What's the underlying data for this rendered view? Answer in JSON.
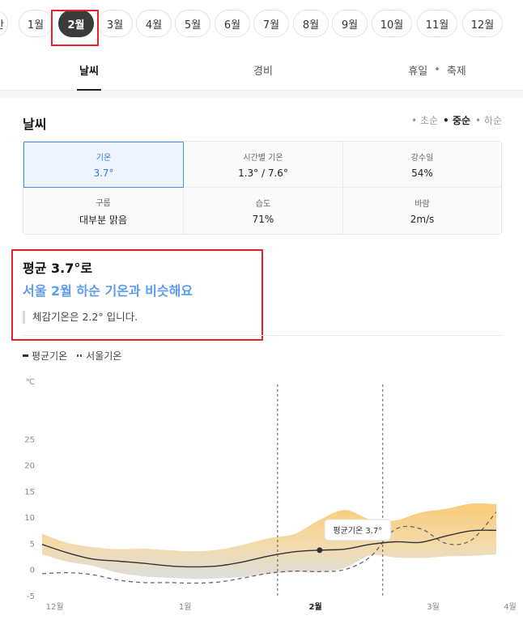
{
  "months": {
    "items": [
      "간",
      "1월",
      "2월",
      "3월",
      "4월",
      "5월",
      "6월",
      "7월",
      "8월",
      "9월",
      "10월",
      "11월",
      "12월"
    ],
    "selected": "2월"
  },
  "tabs": {
    "weather": "날씨",
    "cost": "경비",
    "holiday": "휴일",
    "festival": "축제"
  },
  "section": {
    "title": "날씨",
    "periods": [
      "초순",
      "중순",
      "하순"
    ],
    "selected_period": "중순"
  },
  "stats": [
    {
      "label": "기온",
      "value": "3.7°"
    },
    {
      "label": "시간별 기온",
      "value": "1.3° / 7.6°"
    },
    {
      "label": "강수일",
      "value": "54%"
    },
    {
      "label": "구름",
      "value": "대부분 맑음"
    },
    {
      "label": "습도",
      "value": "71%"
    },
    {
      "label": "바람",
      "value": "2m/s"
    }
  ],
  "summary": {
    "line1": "평균 3.7°로",
    "line2": "서울 2월 하순 기온과 비슷해요",
    "note": "체감기온은 2.2° 입니다."
  },
  "legend": {
    "avg": "평균기온",
    "seoul": "서울기온"
  },
  "colors": {
    "accent": "#5b9cf0",
    "band_top": "#fbc86f",
    "band_bottom": "#e0ddd7",
    "highlight": "#e8212b"
  },
  "chart_data": {
    "type": "area",
    "unit": "℃",
    "ylim": [
      -5,
      30
    ],
    "yticks": [
      -5,
      0,
      5,
      10,
      15,
      20,
      25
    ],
    "xlim": [
      0,
      108
    ],
    "xticks": [
      {
        "label": "12월",
        "x": 3
      },
      {
        "label": "1월",
        "x": 34
      },
      {
        "label": "2월",
        "x": 65
      },
      {
        "label": "3월",
        "x": 93
      },
      {
        "label": "4월",
        "x": 121
      }
    ],
    "current_label": "2월",
    "period_bounds": [
      56,
      81
    ],
    "x": [
      0,
      6,
      12,
      18,
      24,
      30,
      36,
      42,
      48,
      54,
      60,
      66,
      72,
      78,
      84,
      90,
      96,
      102,
      108
    ],
    "series": [
      {
        "name": "평균기온",
        "values": [
          4.8,
          3.2,
          2.0,
          1.6,
          1.2,
          0.7,
          0.5,
          0.7,
          1.5,
          2.6,
          3.4,
          3.7,
          3.9,
          4.8,
          5.3,
          5.2,
          6.4,
          7.4,
          7.5
        ]
      },
      {
        "name": "서울기온",
        "values": [
          -0.8,
          -0.6,
          -1.0,
          -2.0,
          -2.5,
          -2.5,
          -2.6,
          -2.4,
          -1.6,
          -0.7,
          -0.3,
          -0.4,
          0.0,
          2.4,
          7.7,
          7.8,
          5.0,
          5.6,
          11.0
        ]
      },
      {
        "name": "upper",
        "values": [
          6.8,
          5.1,
          4.3,
          3.9,
          4.0,
          3.7,
          3.5,
          3.8,
          4.8,
          6.0,
          6.8,
          9.5,
          11.4,
          9.6,
          9.4,
          10.9,
          11.6,
          12.6,
          12.5
        ]
      },
      {
        "name": "lower",
        "values": [
          2.9,
          1.5,
          0.7,
          -0.6,
          -1.3,
          -1.6,
          -1.8,
          -1.7,
          -1.4,
          -0.8,
          -0.5,
          -0.5,
          0.3,
          2.7,
          2.3,
          2.2,
          2.5,
          2.6,
          2.9
        ]
      }
    ],
    "tooltip": {
      "label": "평균기온 3.7°",
      "x": 66,
      "y": 3.7
    }
  }
}
